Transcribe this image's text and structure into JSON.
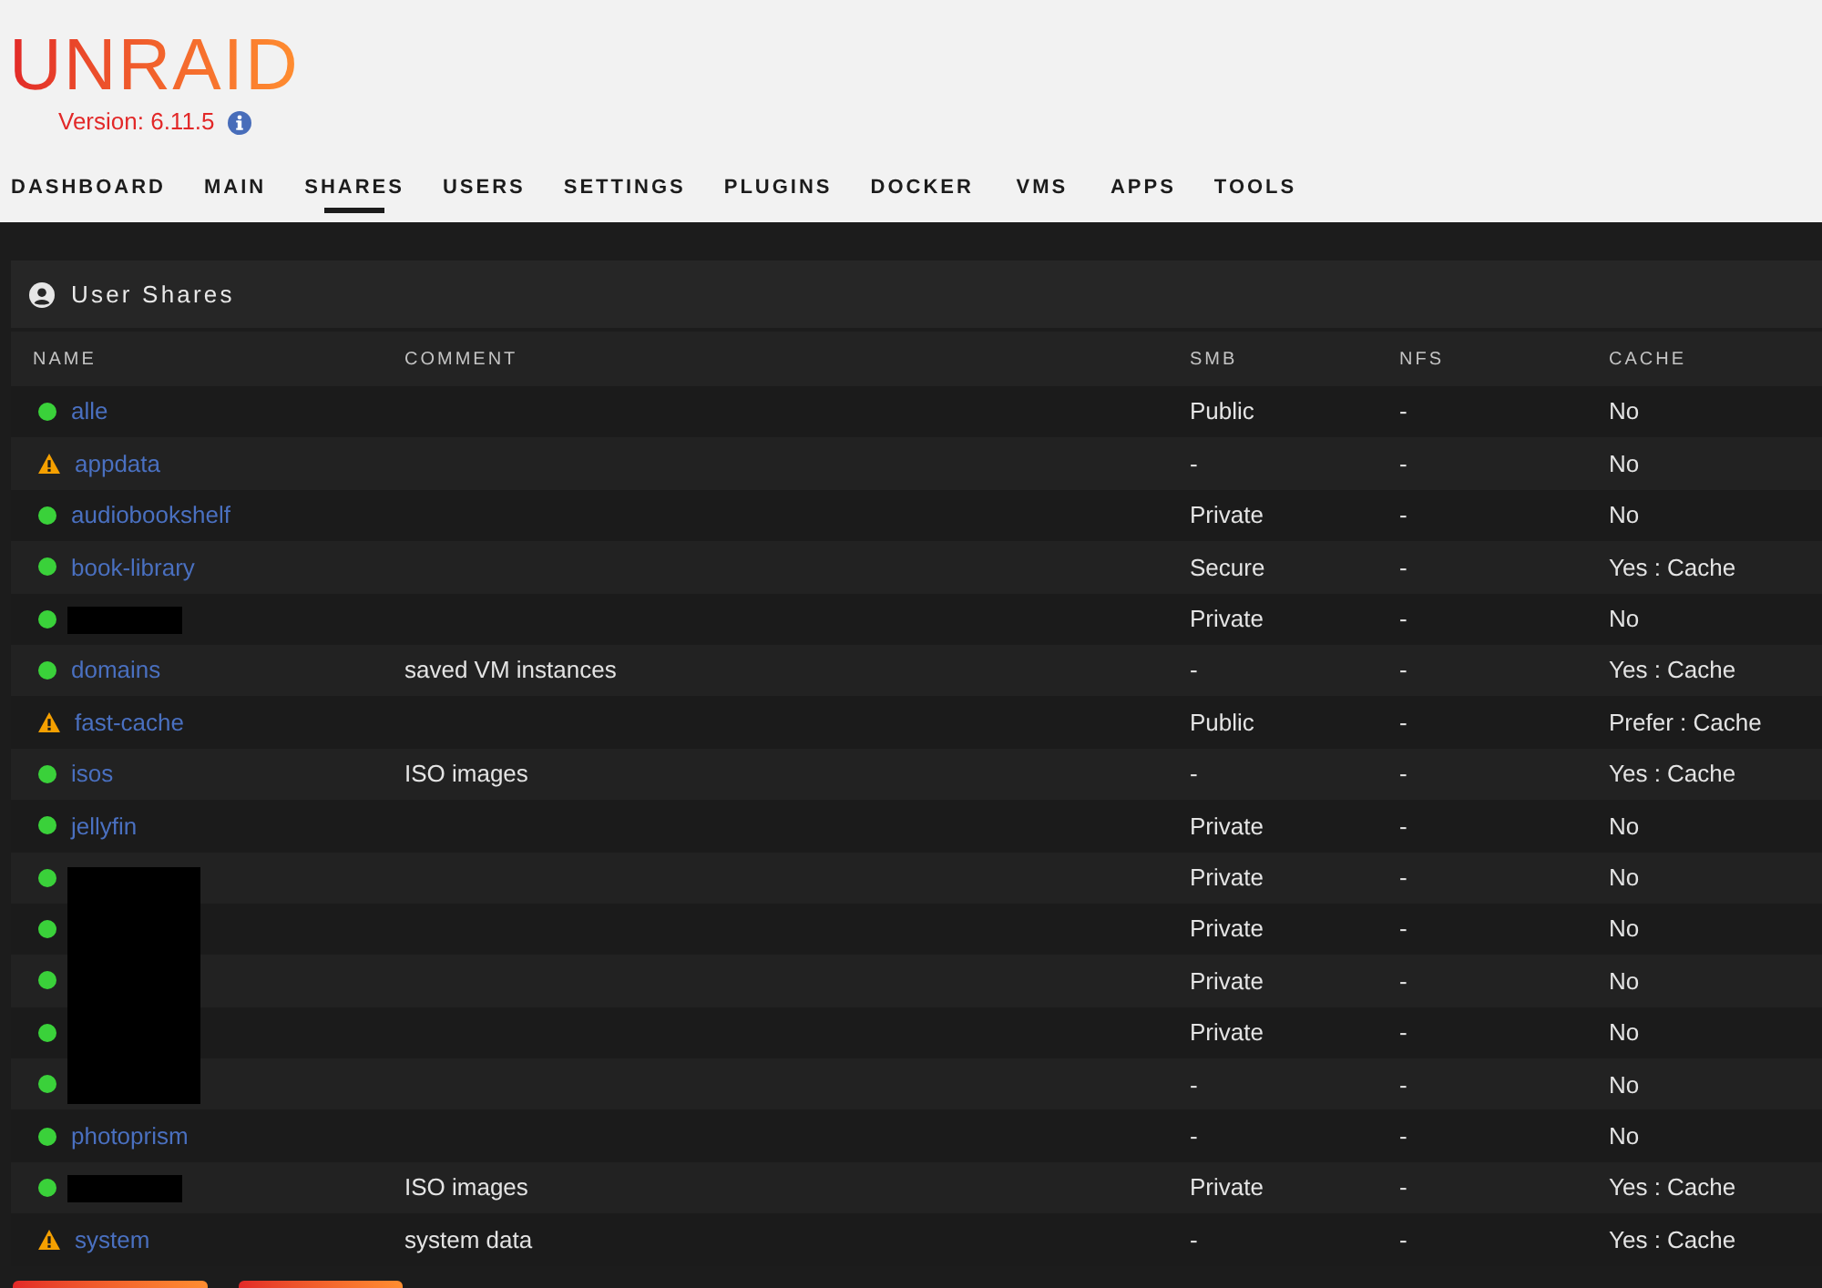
{
  "logo": {
    "text": "UNRAID"
  },
  "version": {
    "text": "Version: 6.11.5"
  },
  "nav": [
    {
      "label": "DASHBOARD",
      "selected": false
    },
    {
      "label": "MAIN",
      "selected": false
    },
    {
      "label": "SHARES",
      "selected": true
    },
    {
      "label": "USERS",
      "selected": false
    },
    {
      "label": "SETTINGS",
      "selected": false
    },
    {
      "label": "PLUGINS",
      "selected": false
    },
    {
      "label": "DOCKER",
      "selected": false
    },
    {
      "label": "VMS",
      "selected": false
    },
    {
      "label": "APPS",
      "selected": false
    },
    {
      "label": "TOOLS",
      "selected": false
    }
  ],
  "panel": {
    "title": "User Shares"
  },
  "table": {
    "columns": [
      "NAME",
      "COMMENT",
      "SMB",
      "NFS",
      "CACHE"
    ],
    "rows": [
      {
        "warning": false,
        "redacted": false,
        "name": "alle",
        "smb": "Public",
        "nfs": "-",
        "cache": "No"
      },
      {
        "warning": true,
        "redacted": false,
        "name": "appdata",
        "smb": "-",
        "nfs": "-",
        "cache": "No"
      },
      {
        "warning": false,
        "redacted": false,
        "name": "audiobookshelf",
        "smb": "Private",
        "nfs": "-",
        "cache": "No"
      },
      {
        "warning": false,
        "redacted": false,
        "name": "book-library",
        "smb": "Secure",
        "nfs": "-",
        "cache": "Yes : Cache"
      },
      {
        "warning": false,
        "redacted": true,
        "smb": "Private",
        "nfs": "-",
        "cache": "No"
      },
      {
        "warning": false,
        "redacted": false,
        "name": "domains",
        "comment": "saved VM instances",
        "smb": "-",
        "nfs": "-",
        "cache": "Yes : Cache"
      },
      {
        "warning": true,
        "redacted": false,
        "name": "fast-cache",
        "smb": "Public",
        "nfs": "-",
        "cache": "Prefer : Cache"
      },
      {
        "warning": false,
        "redacted": false,
        "name": "isos",
        "comment": "ISO images",
        "smb": "-",
        "nfs": "-",
        "cache": "Yes : Cache"
      },
      {
        "warning": false,
        "redacted": false,
        "name": "jellyfin",
        "smb": "Private",
        "nfs": "-",
        "cache": "No"
      },
      {
        "warning": false,
        "redacted": true,
        "smb": "Private",
        "nfs": "-",
        "cache": "No"
      },
      {
        "warning": false,
        "redacted": true,
        "smb": "Private",
        "nfs": "-",
        "cache": "No"
      },
      {
        "warning": false,
        "redacted": true,
        "smb": "Private",
        "nfs": "-",
        "cache": "No"
      },
      {
        "warning": false,
        "redacted": true,
        "smb": "Private",
        "nfs": "-",
        "cache": "No"
      },
      {
        "warning": false,
        "redacted": true,
        "smb": "-",
        "nfs": "-",
        "cache": "No"
      },
      {
        "warning": false,
        "redacted": false,
        "name": "photoprism",
        "smb": "-",
        "nfs": "-",
        "cache": "No"
      },
      {
        "warning": false,
        "redacted": true,
        "comment": "ISO images",
        "smb": "Private",
        "nfs": "-",
        "cache": "Yes : Cache"
      },
      {
        "warning": true,
        "redacted": false,
        "name": "system",
        "comment": "system data",
        "smb": "-",
        "nfs": "-",
        "cache": "Yes : Cache"
      }
    ]
  }
}
